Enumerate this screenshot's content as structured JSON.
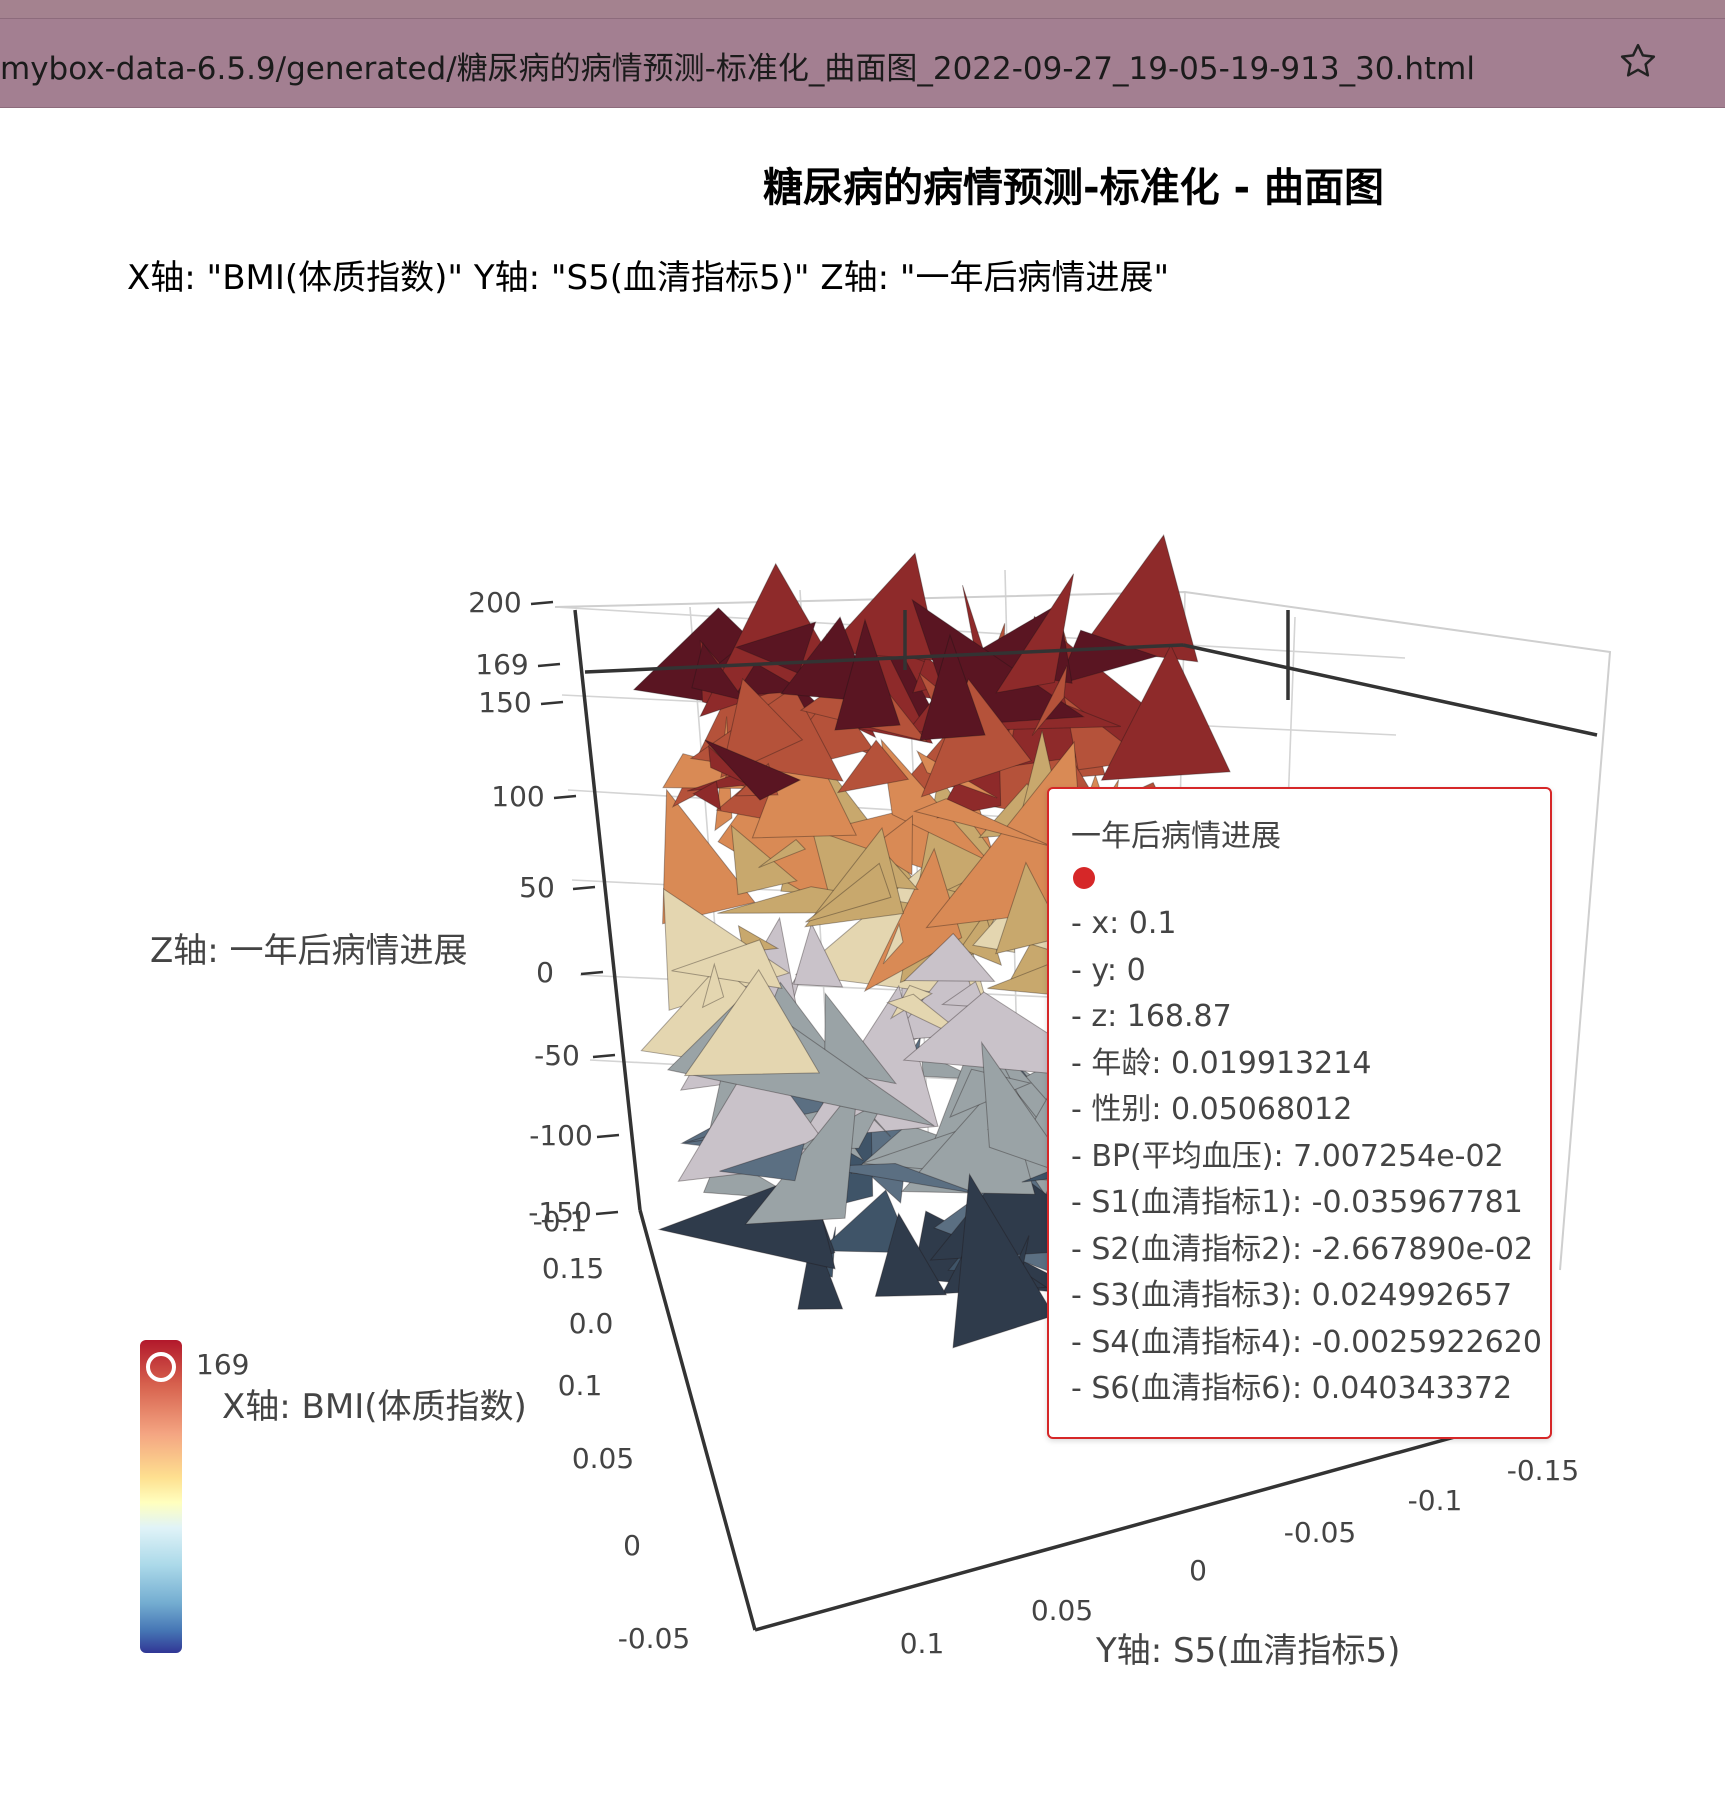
{
  "browser": {
    "address": "mybox-data-6.5.9/generated/糖尿病的病情预测-标准化_曲面图_2022-09-27_19-05-19-913_30.html",
    "star_icon": "star-icon"
  },
  "page": {
    "title": "糖尿病的病情预测-标准化 - 曲面图",
    "subtitle": "X轴: \"BMI(体质指数)\" Y轴: \"S5(血清指标5)\" Z轴: \"一年后病情进展\""
  },
  "chart_data": {
    "type": "surface",
    "zlabel": "Z轴: 一年后病情进展",
    "xlabel": "X轴: BMI(体质指数)",
    "ylabel": "Y轴: S5(血清指标5)",
    "z_ticks": [
      "200",
      "169",
      "150",
      "100",
      "50",
      "0",
      "-50",
      "-100",
      "-150"
    ],
    "x_ticks": [
      "0.15",
      "0.1",
      "0.05",
      "0",
      "-0.05",
      "-0.1"
    ],
    "y_ticks": [
      "-0.15",
      "-0.1",
      "-0.05",
      "0",
      "0.05",
      "0.1"
    ],
    "overlap_ticks": [
      "-0.1",
      "0.0"
    ],
    "colorscale": [
      "#313695",
      "#4575b4",
      "#74add1",
      "#abd9e9",
      "#e0f3f8",
      "#ffffbf",
      "#fee090",
      "#f4a582",
      "#d6604d",
      "#b2182b"
    ],
    "colorbar_max": "169",
    "hover": {
      "name": "一年后病情进展",
      "color": "#d62728",
      "rows": [
        "- x: 0.1",
        "- y: 0",
        "- z: 168.87",
        "- 年龄: 0.019913214",
        "- 性别: 0.05068012",
        "- BP(平均血压): 7.007254e-02",
        "- S1(血清指标1): -0.035967781",
        "- S2(血清指标2): -2.667890e-02",
        "- S3(血清指标3): 0.024992657",
        "- S4(血清指标4): -0.0025922620",
        "- S6(血清指标6): 0.040343372"
      ]
    }
  }
}
